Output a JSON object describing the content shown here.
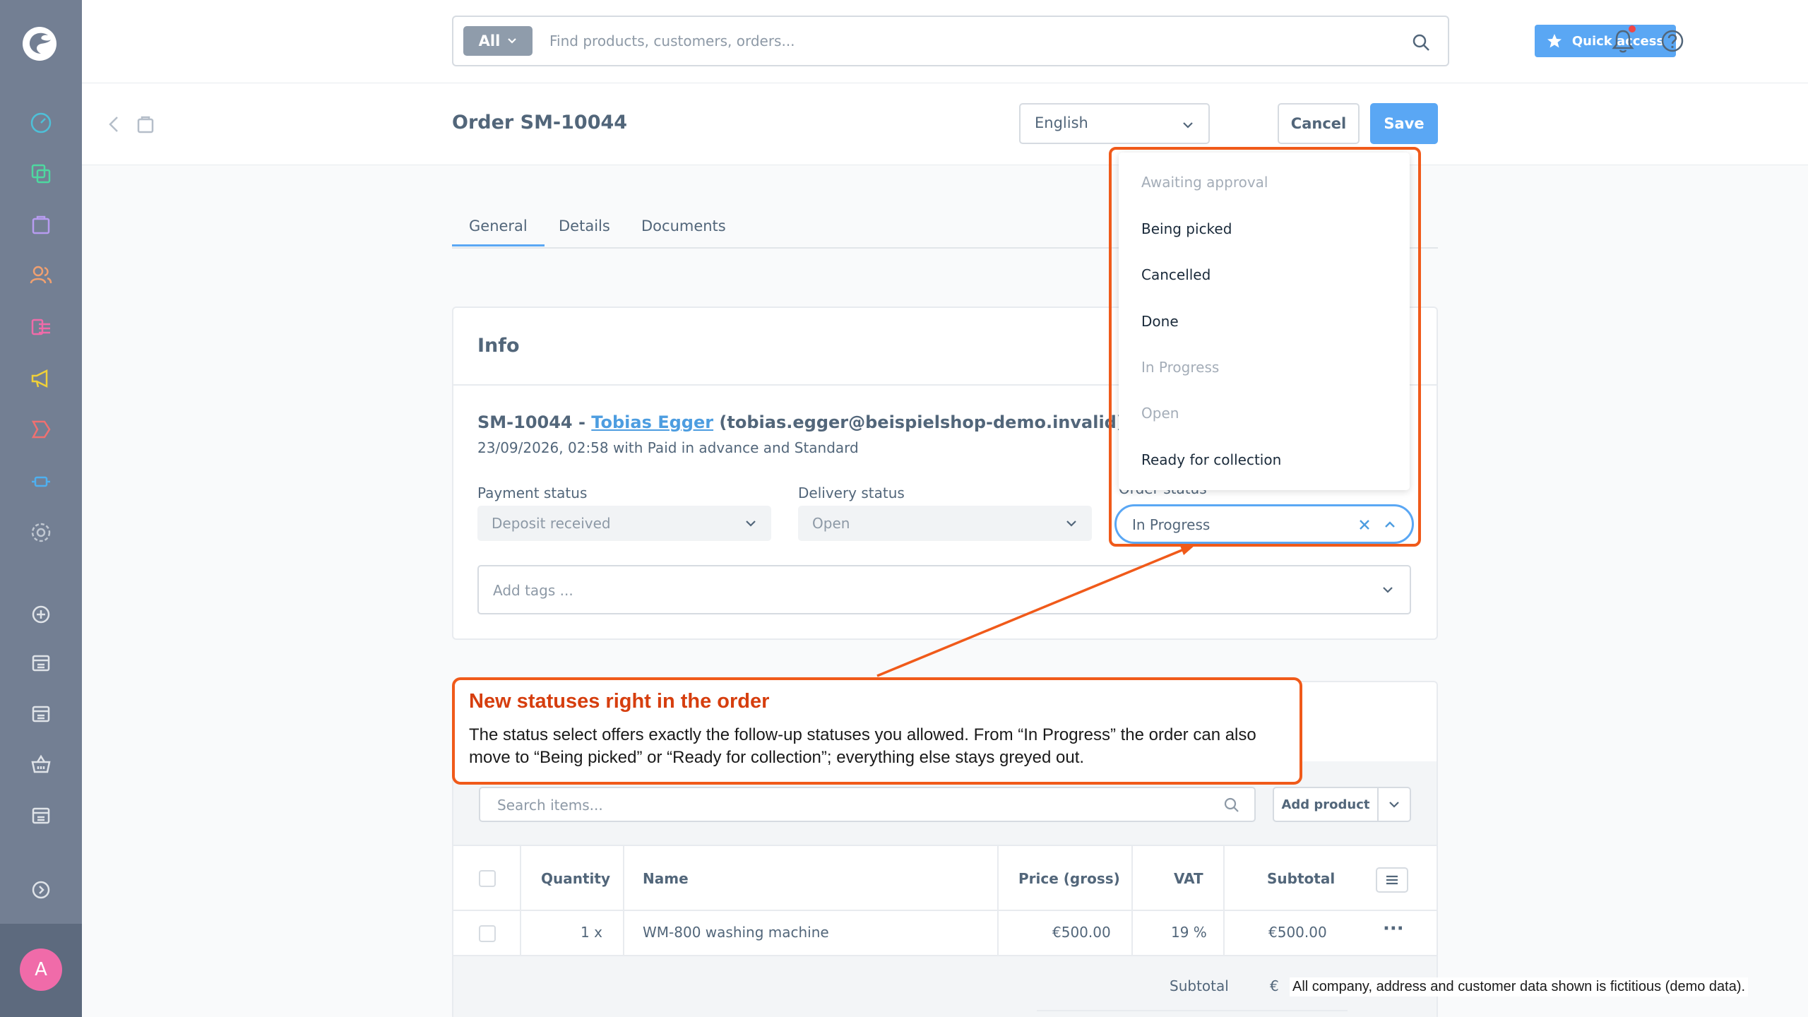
{
  "header": {
    "search_scope": "All",
    "search_placeholder": "Find products, customers, orders...",
    "quick_access_label": "Quick access"
  },
  "smartbar": {
    "title": "Order SM-10044",
    "language": "English",
    "cancel_label": "Cancel",
    "save_label": "Save"
  },
  "tabs": [
    {
      "label": "General",
      "active": true
    },
    {
      "label": "Details",
      "active": false
    },
    {
      "label": "Documents",
      "active": false
    }
  ],
  "info": {
    "title": "Info",
    "order_number": "SM-10044 - ",
    "customer_name": "Tobias Egger",
    "customer_email": " (tobias.egger@beispielshop-demo.invalid)",
    "order_meta": "23/09/2026, 02:58 with Paid in advance and Standard",
    "payment_status_label": "Payment status",
    "payment_status_value": "Deposit received",
    "delivery_status_label": "Delivery status",
    "delivery_status_value": "Open",
    "order_status_label": "Order status",
    "order_status_value": "In Progress",
    "tags_placeholder": "Add tags ..."
  },
  "status_options": [
    {
      "label": "Awaiting approval",
      "disabled": true
    },
    {
      "label": "Being picked",
      "disabled": false
    },
    {
      "label": "Cancelled",
      "disabled": false
    },
    {
      "label": "Done",
      "disabled": false
    },
    {
      "label": "In Progress",
      "disabled": true
    },
    {
      "label": "Open",
      "disabled": true
    },
    {
      "label": "Ready for collection",
      "disabled": false
    }
  ],
  "callout": {
    "title": "New statuses right in the order",
    "text": "The status select offers exactly the follow-up statuses you allowed. From “In Progress” the order can also move to “Being picked” or “Ready for collection”; everything else stays greyed out."
  },
  "items": {
    "search_placeholder": "Search items...",
    "add_product_label": "Add product",
    "columns": [
      "Quantity",
      "Name",
      "Price (gross)",
      "VAT",
      "Subtotal"
    ],
    "rows": [
      {
        "quantity": "1 x",
        "name": "WM-800 washing machine",
        "price": "€500.00",
        "vat": "19 %",
        "subtotal": "€500.00"
      }
    ],
    "subtotal_label": "Subtotal",
    "subtotal_value_partial": "€"
  },
  "user": {
    "avatar_initial": "A"
  },
  "disclaimer": "All company, address and customer data shown is fictitious (demo data).",
  "colors": {
    "sidebar": "#737f93",
    "accent": "#5aa7f4",
    "highlight": "#f05a1a",
    "callout_title": "#d63e0e"
  },
  "sidebar_icons": [
    "dashboard-icon",
    "catalogue-icon",
    "orders-icon",
    "customers-icon",
    "content-icon",
    "marketing-icon",
    "extensions-icon",
    "plugin-icon",
    "settings-icon",
    "add-sales-channel-icon",
    "storefront-icon",
    "storefront-icon",
    "headless-icon",
    "storefront-icon",
    "expand-icon"
  ]
}
